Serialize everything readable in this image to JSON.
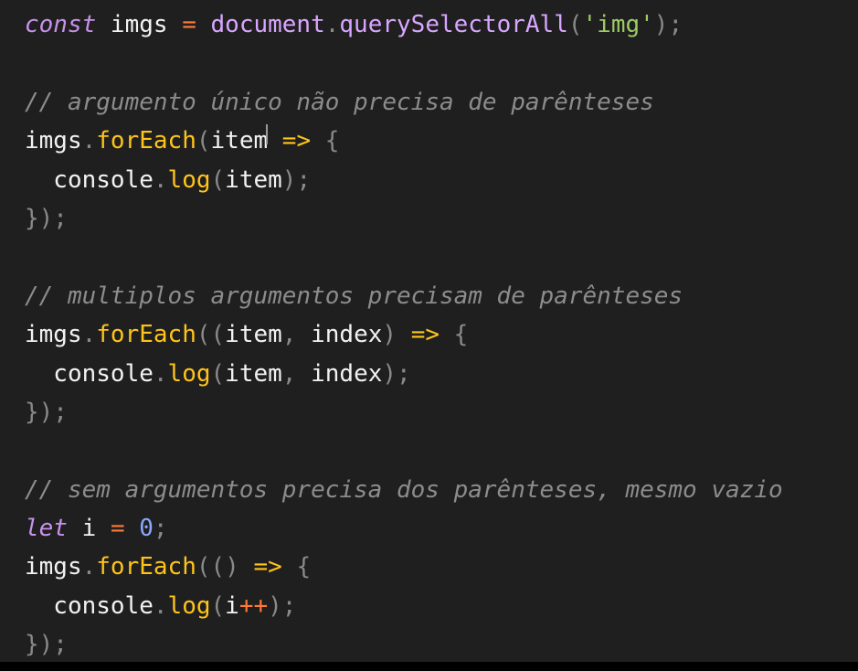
{
  "editor": {
    "lines": [
      [
        {
          "t": "const",
          "c": "kw"
        },
        {
          "t": " imgs ",
          "c": "pl"
        },
        {
          "t": "=",
          "c": "op"
        },
        {
          "t": " document",
          "c": "kw2"
        },
        {
          "t": ".",
          "c": "pu"
        },
        {
          "t": "querySelectorAll",
          "c": "kw2"
        },
        {
          "t": "(",
          "c": "pu"
        },
        {
          "t": "'img'",
          "c": "st"
        },
        {
          "t": ");",
          "c": "pu"
        }
      ],
      [],
      [
        {
          "t": "// argumento único não precisa de parênteses",
          "c": "cm"
        }
      ],
      [
        {
          "t": "imgs",
          "c": "pl"
        },
        {
          "t": ".",
          "c": "pu"
        },
        {
          "t": "forEach",
          "c": "fn"
        },
        {
          "t": "(",
          "c": "pu"
        },
        {
          "t": "item",
          "c": "pl"
        },
        {
          "t": "",
          "c": "cursor"
        },
        {
          "t": " ",
          "c": "pl"
        },
        {
          "t": "=>",
          "c": "ar"
        },
        {
          "t": " {",
          "c": "pu"
        }
      ],
      [
        {
          "t": "  console",
          "c": "pl"
        },
        {
          "t": ".",
          "c": "pu"
        },
        {
          "t": "log",
          "c": "fn"
        },
        {
          "t": "(",
          "c": "pu"
        },
        {
          "t": "item",
          "c": "pl"
        },
        {
          "t": ");",
          "c": "pu"
        }
      ],
      [
        {
          "t": "});",
          "c": "pu"
        }
      ],
      [],
      [
        {
          "t": "// multiplos argumentos precisam de parênteses",
          "c": "cm"
        }
      ],
      [
        {
          "t": "imgs",
          "c": "pl"
        },
        {
          "t": ".",
          "c": "pu"
        },
        {
          "t": "forEach",
          "c": "fn"
        },
        {
          "t": "((",
          "c": "pu"
        },
        {
          "t": "item",
          "c": "pl"
        },
        {
          "t": ", ",
          "c": "pu"
        },
        {
          "t": "index",
          "c": "pl"
        },
        {
          "t": ") ",
          "c": "pu"
        },
        {
          "t": "=>",
          "c": "ar"
        },
        {
          "t": " {",
          "c": "pu"
        }
      ],
      [
        {
          "t": "  console",
          "c": "pl"
        },
        {
          "t": ".",
          "c": "pu"
        },
        {
          "t": "log",
          "c": "fn"
        },
        {
          "t": "(",
          "c": "pu"
        },
        {
          "t": "item",
          "c": "pl"
        },
        {
          "t": ", ",
          "c": "pu"
        },
        {
          "t": "index",
          "c": "pl"
        },
        {
          "t": ");",
          "c": "pu"
        }
      ],
      [
        {
          "t": "});",
          "c": "pu"
        }
      ],
      [],
      [
        {
          "t": "// sem argumentos precisa dos parênteses, mesmo vazio",
          "c": "cm"
        }
      ],
      [
        {
          "t": "let",
          "c": "kw"
        },
        {
          "t": " i ",
          "c": "pl"
        },
        {
          "t": "=",
          "c": "op"
        },
        {
          "t": " ",
          "c": "pl"
        },
        {
          "t": "0",
          "c": "nu"
        },
        {
          "t": ";",
          "c": "pu"
        }
      ],
      [
        {
          "t": "imgs",
          "c": "pl"
        },
        {
          "t": ".",
          "c": "pu"
        },
        {
          "t": "forEach",
          "c": "fn"
        },
        {
          "t": "(() ",
          "c": "pu"
        },
        {
          "t": "=>",
          "c": "ar"
        },
        {
          "t": " {",
          "c": "pu"
        }
      ],
      [
        {
          "t": "  console",
          "c": "pl"
        },
        {
          "t": ".",
          "c": "pu"
        },
        {
          "t": "log",
          "c": "fn"
        },
        {
          "t": "(",
          "c": "pu"
        },
        {
          "t": "i",
          "c": "pl"
        },
        {
          "t": "++",
          "c": "op"
        },
        {
          "t": ");",
          "c": "pu"
        }
      ],
      [
        {
          "t": "});",
          "c": "pu"
        }
      ]
    ]
  },
  "colors": {
    "background": "#1f1f1f",
    "comment": "#8c8c8c",
    "keyword": "#c792ea",
    "function": "#ffc41a",
    "operator": "#ff7b39",
    "string": "#9ccc65",
    "number": "#89a8ff",
    "punctuation": "#8a8a8a",
    "text": "#f2f2f2"
  }
}
